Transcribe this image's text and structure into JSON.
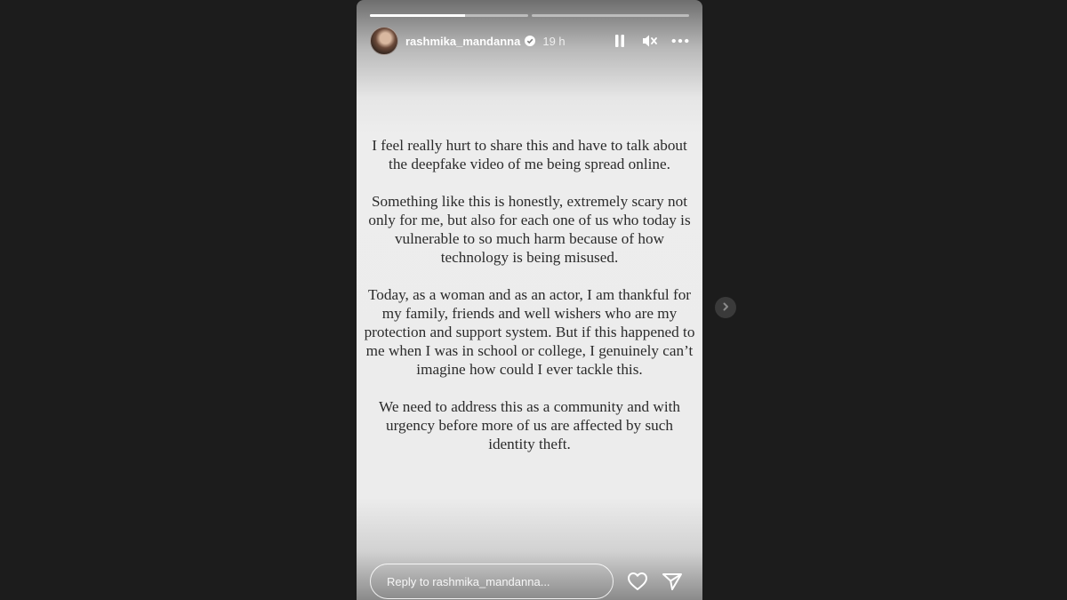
{
  "story": {
    "username": "rashmika_mandanna",
    "time": "19 h",
    "progress": [
      0.6,
      0.0
    ],
    "paragraphs": [
      "I feel really hurt to share this and have to talk about the deepfake video of me being spread online.",
      "Something like this is honestly, extremely scary not only for me, but also for each one of us who today is vulnerable to so much harm because of how technology is being misused.",
      "Today, as a woman and as an actor, I am thankful for my family, friends and well wishers who are my protection and support system. But if this happened to me when I was in school or college, I genuinely can’t imagine how could I ever tackle this.",
      "We need to address this as a community and with urgency before more of us are affected by such identity theft."
    ]
  },
  "controls": {
    "pause_icon": "pause-icon",
    "mute_icon": "muted-speaker-icon",
    "more_icon": "more-options-icon"
  },
  "footer": {
    "reply_placeholder": "Reply to rashmika_mandanna...",
    "like_icon": "heart-icon",
    "send_icon": "send-icon"
  },
  "nav": {
    "next_icon": "chevron-right-icon"
  },
  "colors": {
    "background": "#1c1c1c",
    "story_card": "#ececec",
    "text": "#2b2b2b",
    "verified": "#ffffff"
  }
}
